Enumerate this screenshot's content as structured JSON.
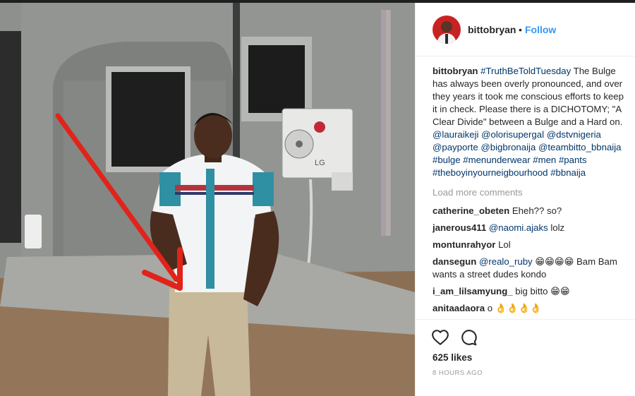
{
  "post": {
    "username": "bittobryan",
    "follow_separator": "•",
    "follow_label": "Follow"
  },
  "caption": {
    "username": "bittobryan",
    "hashtag_first": "#TruthBeToldTuesday",
    "text": "The Bulge has always been overly pronounced, and over they years it took me conscious efforts to keep it in check. Please there is a DICHOTOMY; \"A Clear Divide\" between a Bulge and a Hard on.",
    "mentions": [
      "@lauraikeji",
      "@olorisupergal",
      "@dstvnigeria",
      "@payporte",
      "@bigbronaija",
      "@teambitto_bbnaija"
    ],
    "hashtags": [
      "#bulge",
      "#menunderwear",
      "#men",
      "#pants",
      "#theboyinyourneigbourhood",
      "#bbnaija"
    ]
  },
  "load_more": "Load more comments",
  "comments": [
    {
      "user": "catherine_obeten",
      "text": "Eheh?? so?"
    },
    {
      "user": "janerous411",
      "mention": "@naomi.ajaks",
      "text": " lolz"
    },
    {
      "user": "montunrahyor",
      "text": "Lol"
    },
    {
      "user": "dansegun",
      "mention": "@realo_ruby",
      "text": " 😁😁😁😁 Bam Bam wants a street dudes kondo"
    },
    {
      "user": "i_am_lilsamyung_",
      "text": "big bitto 😁😁"
    },
    {
      "user": "anitaadaora",
      "text": "o 👌👌👌👌"
    }
  ],
  "stats": {
    "likes": "625 likes",
    "time": "8 HOURS AGO"
  },
  "icons": {
    "like": "heart-outline-icon",
    "comment": "speech-bubble-icon"
  },
  "photo": {
    "ac_brand": "LG",
    "arrow_color": "#e2231a"
  },
  "colors": {
    "link": "#003569",
    "follow": "#3897f0",
    "muted": "#999999"
  }
}
